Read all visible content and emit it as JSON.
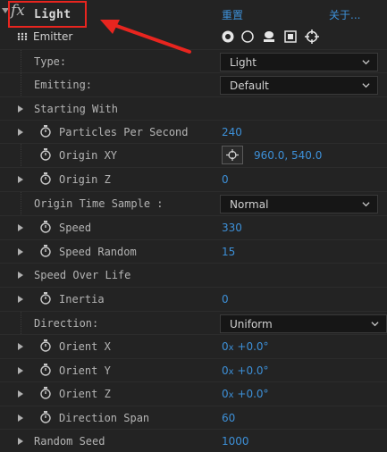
{
  "header": {
    "fx_label": "fx",
    "effect_name": "Light",
    "reset_label": "重置",
    "about_label": "关于..."
  },
  "emitter": {
    "label": "Emitter"
  },
  "rows": {
    "type": {
      "label": "Type:",
      "value": "Light"
    },
    "emitting": {
      "label": "Emitting:",
      "value": "Default"
    },
    "starting_with": {
      "label": "Starting With"
    },
    "particles_per_second": {
      "label": "Particles Per Second",
      "value": "240"
    },
    "origin_xy": {
      "label": "Origin XY",
      "value": "960.0, 540.0"
    },
    "origin_z": {
      "label": "Origin Z",
      "value": "0"
    },
    "origin_time_sample": {
      "label": "Origin Time Sample :",
      "value": "Normal"
    },
    "speed": {
      "label": "Speed",
      "value": "330"
    },
    "speed_random": {
      "label": "Speed Random",
      "value": "15"
    },
    "speed_over_life": {
      "label": "Speed Over Life"
    },
    "inertia": {
      "label": "Inertia",
      "value": "0"
    },
    "direction": {
      "label": "Direction:",
      "value": "Uniform"
    },
    "orient_x": {
      "label": "Orient X",
      "value_rev": "0",
      "rev_suffix": "x",
      "value_deg": "+0.0°"
    },
    "orient_y": {
      "label": "Orient Y",
      "value_rev": "0",
      "rev_suffix": "x",
      "value_deg": "+0.0°"
    },
    "orient_z": {
      "label": "Orient Z",
      "value_rev": "0",
      "rev_suffix": "x",
      "value_deg": "+0.0°"
    },
    "direction_span": {
      "label": "Direction Span",
      "value": "60"
    },
    "random_seed": {
      "label": "Random Seed",
      "value": "1000"
    }
  },
  "colors": {
    "panel_bg": "#232323",
    "value_blue": "#3d90d8",
    "highlight_red": "#e8251f",
    "label_gray": "#b4b4b4"
  },
  "icons": [
    "twirl-down-icon",
    "emitter-icon",
    "disc-icon",
    "circle-icon",
    "stack-icon",
    "square-icon",
    "crosshair-icon",
    "twirl-right-icon",
    "stopwatch-icon",
    "chevron-down-icon",
    "point-picker-icon",
    "arrow-annotation"
  ]
}
